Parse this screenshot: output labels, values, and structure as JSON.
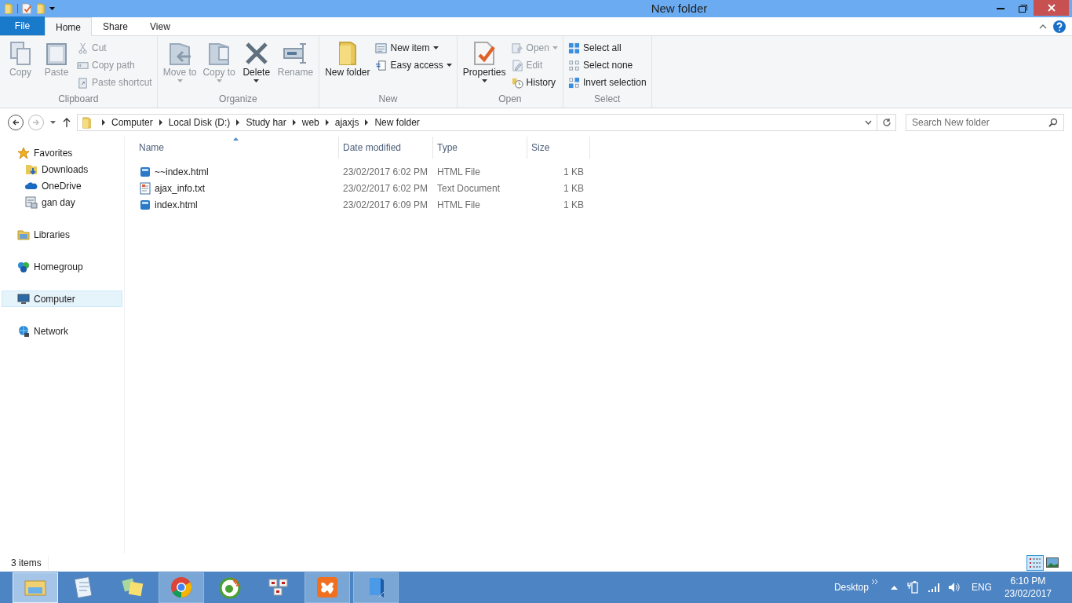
{
  "window": {
    "title": "New folder"
  },
  "ribbon_tabs": [
    {
      "label": "File",
      "kind": "file",
      "selected": false
    },
    {
      "label": "Home",
      "kind": "tab",
      "selected": true
    },
    {
      "label": "Share",
      "kind": "tab",
      "selected": false
    },
    {
      "label": "View",
      "kind": "tab",
      "selected": false
    }
  ],
  "ribbon_groups": [
    {
      "label": "Clipboard",
      "large": [
        {
          "label": "Copy",
          "kind": "copy",
          "disabled": true
        },
        {
          "label": "Paste",
          "kind": "paste",
          "disabled": true
        }
      ],
      "small": [
        {
          "label": "Cut",
          "kind": "cut",
          "disabled": true
        },
        {
          "label": "Copy path",
          "kind": "path",
          "disabled": true
        },
        {
          "label": "Paste shortcut",
          "kind": "shortcut",
          "disabled": true
        }
      ]
    },
    {
      "label": "Organize",
      "large": [
        {
          "label": "Move to",
          "kind": "move",
          "disabled": true,
          "dropdown": true
        },
        {
          "label": "Copy to",
          "kind": "copyto",
          "disabled": true,
          "dropdown": true
        },
        {
          "label": "Delete",
          "kind": "delete",
          "disabled": false,
          "dropdown": true
        },
        {
          "label": "Rename",
          "kind": "rename",
          "disabled": true,
          "dropdown": false
        }
      ]
    },
    {
      "label": "New",
      "large": [
        {
          "label": "New folder",
          "kind": "folder",
          "disabled": false
        }
      ],
      "small": [
        {
          "label": "New item",
          "kind": "newitem",
          "disabled": false,
          "dropdown": true
        },
        {
          "label": "Easy access",
          "kind": "easy",
          "disabled": false,
          "dropdown": true
        }
      ]
    },
    {
      "label": "Open",
      "large": [
        {
          "label": "Properties",
          "kind": "properties",
          "disabled": false,
          "dropdown": true
        }
      ],
      "small": [
        {
          "label": "Open",
          "kind": "open",
          "disabled": true,
          "dropdown": true
        },
        {
          "label": "Edit",
          "kind": "edit",
          "disabled": true,
          "dropdown": false
        },
        {
          "label": "History",
          "kind": "history",
          "disabled": false,
          "dropdown": false
        }
      ]
    },
    {
      "label": "Select",
      "small": [
        {
          "label": "Select all",
          "kind": "selall",
          "disabled": false
        },
        {
          "label": "Select none",
          "kind": "selnone",
          "disabled": false
        },
        {
          "label": "Invert selection",
          "kind": "invert",
          "disabled": false
        }
      ]
    }
  ],
  "address": {
    "path": [
      "Computer",
      "Local Disk (D:)",
      "Study har",
      "web",
      "ajaxjs",
      "New folder"
    ]
  },
  "search": {
    "placeholder": "Search New folder"
  },
  "sidebar": {
    "items": [
      {
        "label": "Favorites",
        "kind": "star",
        "selected": false,
        "children": [
          {
            "label": "Downloads",
            "kind": "downloads",
            "selected": false
          },
          {
            "label": "OneDrive",
            "kind": "cloud",
            "selected": false
          },
          {
            "label": "gan day",
            "kind": "recent",
            "selected": false
          }
        ]
      },
      {
        "label": "Libraries",
        "kind": "libraries",
        "selected": false
      },
      {
        "label": "Homegroup",
        "kind": "homegroup",
        "selected": false
      },
      {
        "label": "Computer",
        "kind": "computer",
        "selected": true
      },
      {
        "label": "Network",
        "kind": "network",
        "selected": false
      }
    ]
  },
  "table": {
    "columns": [
      "Name",
      "Date modified",
      "Type",
      "Size"
    ],
    "rows": [
      {
        "name": "~~index.html",
        "kind": "html",
        "date": "23/02/2017 6:02 PM",
        "type": "HTML File",
        "size": "1 KB"
      },
      {
        "name": "ajax_info.txt",
        "kind": "text",
        "date": "23/02/2017 6:02 PM",
        "type": "Text Document",
        "size": "1 KB"
      },
      {
        "name": "index.html",
        "kind": "html",
        "date": "23/02/2017 6:09 PM",
        "type": "HTML File",
        "size": "1 KB"
      }
    ]
  },
  "status_bar": {
    "count": "3 items",
    "views": [
      {
        "kind": "details",
        "selected": true
      },
      {
        "kind": "large",
        "selected": false
      }
    ]
  },
  "taskbar": {
    "apps": [
      {
        "kind": "explorer",
        "open": true,
        "selected": true
      },
      {
        "kind": "notepad",
        "open": false,
        "selected": false
      },
      {
        "kind": "notes",
        "open": false,
        "selected": false
      },
      {
        "kind": "chrome",
        "open": true,
        "selected": false
      },
      {
        "kind": "coccoc",
        "open": false,
        "selected": false
      },
      {
        "kind": "unikey",
        "open": false,
        "selected": false
      },
      {
        "kind": "xampp",
        "open": true,
        "selected": false
      },
      {
        "kind": "book",
        "open": true,
        "selected": false
      }
    ],
    "desktop": "Desktop",
    "language": "ENG",
    "time": "6:10 PM",
    "date": "23/02/2017"
  }
}
